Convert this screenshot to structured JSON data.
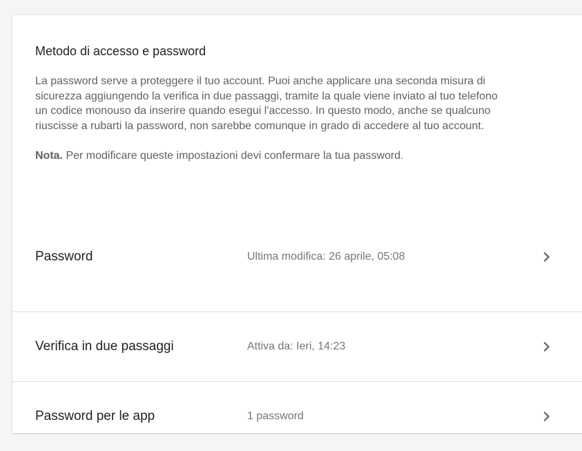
{
  "section": {
    "title": "Metodo di accesso e password",
    "description": "La password serve a proteggere il tuo account. Puoi anche applicare una seconda misura di sicurezza aggiungendo la verifica in due passaggi, tramite la quale viene inviato al tuo telefono un codice monouso da inserire quando esegui l'accesso. In questo modo, anche se qualcuno riuscisse a rubarti la password, non sarebbe comunque in grado di accedere al tuo account.",
    "note_label": "Nota.",
    "note_text": " Per modificare queste impostazioni devi confermare la tua password."
  },
  "rows": [
    {
      "label": "Password",
      "value": "Ultima modifica: 26 aprile, 05:08",
      "icon": "chevron-right-icon"
    },
    {
      "label": "Verifica in due passaggi",
      "value": "Attiva da: Ieri, 14:23",
      "icon": "chevron-right-icon"
    },
    {
      "label": "Password per le app",
      "value": "1 password",
      "icon": "chevron-right-icon"
    }
  ],
  "colors": {
    "background": "#f5f5f5",
    "card": "#ffffff",
    "primary_text": "#212121",
    "secondary_text": "#616161",
    "value_text": "#757575",
    "divider": "#e0e0e0",
    "chevron": "#616161"
  }
}
